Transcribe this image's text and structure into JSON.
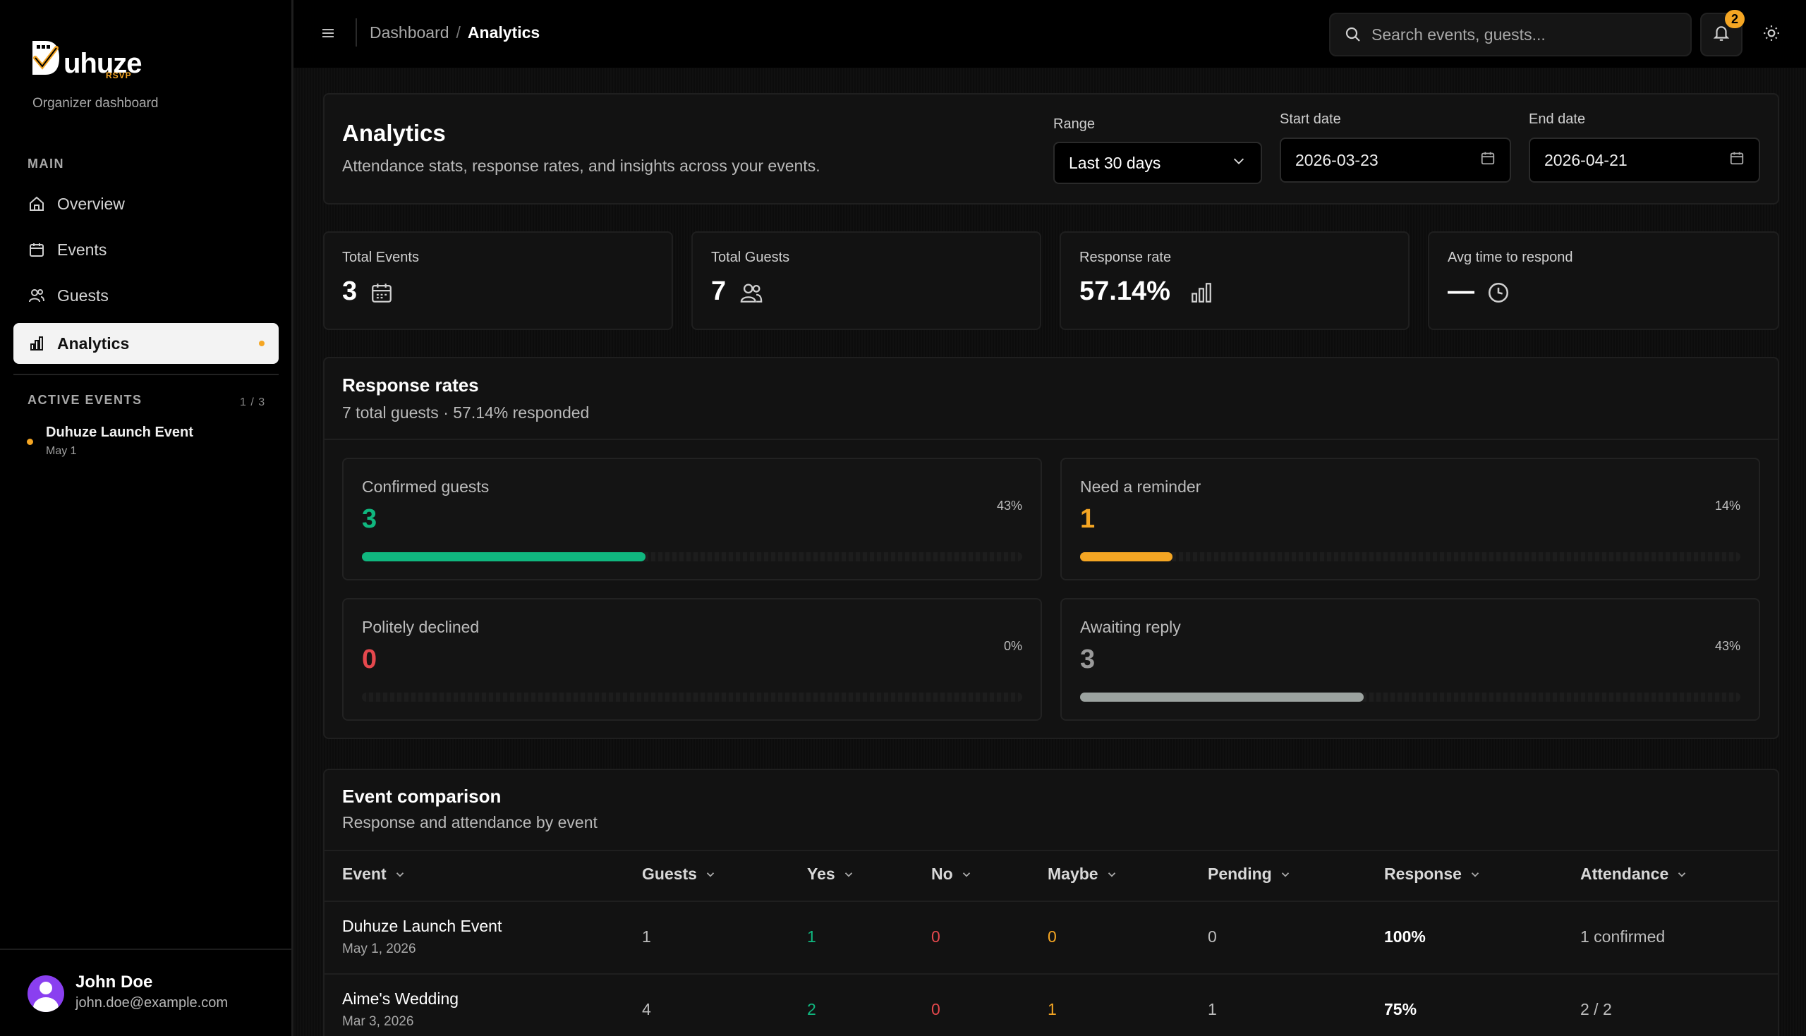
{
  "brand": {
    "name": "uhuze",
    "sub": "RSVP",
    "tagline": "Organizer dashboard"
  },
  "sidebar": {
    "main_label": "MAIN",
    "items": [
      {
        "label": "Overview",
        "icon": "home-icon"
      },
      {
        "label": "Events",
        "icon": "calendar-icon"
      },
      {
        "label": "Guests",
        "icon": "users-icon"
      },
      {
        "label": "Analytics",
        "icon": "bar-chart-icon",
        "active": true
      }
    ],
    "active_events_label": "ACTIVE EVENTS",
    "active_events_count": "1 / 3",
    "active_events": [
      {
        "name": "Duhuze Launch Event",
        "date": "May 1"
      }
    ]
  },
  "user": {
    "name": "John Doe",
    "email": "john.doe@example.com"
  },
  "topbar": {
    "breadcrumb_root": "Dashboard",
    "breadcrumb_sep": "/",
    "breadcrumb_current": "Analytics",
    "search_placeholder": "Search events, guests...",
    "notification_count": "2"
  },
  "header": {
    "title": "Analytics",
    "subtitle": "Attendance stats, response rates, and insights across your events.",
    "range_label": "Range",
    "range_value": "Last 30 days",
    "start_label": "Start date",
    "start_value": "2026-03-23",
    "end_label": "End date",
    "end_value": "2026-04-21"
  },
  "stats": [
    {
      "label": "Total Events",
      "value": "3",
      "icon": "calendar-icon"
    },
    {
      "label": "Total Guests",
      "value": "7",
      "icon": "users-icon"
    },
    {
      "label": "Response rate",
      "value": "57.14%",
      "icon": "bar-chart-icon"
    },
    {
      "label": "Avg time to respond",
      "value": "—",
      "icon": "clock-icon"
    }
  ],
  "response_rates": {
    "title": "Response rates",
    "subtitle": "7 total guests · 57.14% responded",
    "metrics": [
      {
        "label": "Confirmed guests",
        "value": "3",
        "pct": "43%",
        "fraction": 0.43,
        "color": "#10b77f"
      },
      {
        "label": "Need a reminder",
        "value": "1",
        "pct": "14%",
        "fraction": 0.14,
        "color": "#f5a623"
      },
      {
        "label": "Politely declined",
        "value": "0",
        "pct": "0%",
        "fraction": 0.0,
        "color": "#e5484d"
      },
      {
        "label": "Awaiting reply",
        "value": "3",
        "pct": "43%",
        "fraction": 0.43,
        "color": "#9ca3a0"
      }
    ]
  },
  "event_comparison": {
    "title": "Event comparison",
    "subtitle": "Response and attendance by event",
    "columns": [
      "Event",
      "Guests",
      "Yes",
      "No",
      "Maybe",
      "Pending",
      "Response",
      "Attendance"
    ],
    "rows": [
      {
        "event": "Duhuze Launch Event",
        "date": "May 1, 2026",
        "guests": "1",
        "yes": "1",
        "no": "0",
        "maybe": "0",
        "pending": "0",
        "response": "100%",
        "attendance": "1 confirmed"
      },
      {
        "event": "Aime's Wedding",
        "date": "Mar 3, 2026",
        "guests": "4",
        "yes": "2",
        "no": "0",
        "maybe": "1",
        "pending": "1",
        "response": "75%",
        "attendance": "2 / 2"
      }
    ]
  },
  "colors": {
    "accent": "#f5a623",
    "yes": "#10b77f",
    "no": "#e5484d",
    "maybe": "#f5a623"
  }
}
